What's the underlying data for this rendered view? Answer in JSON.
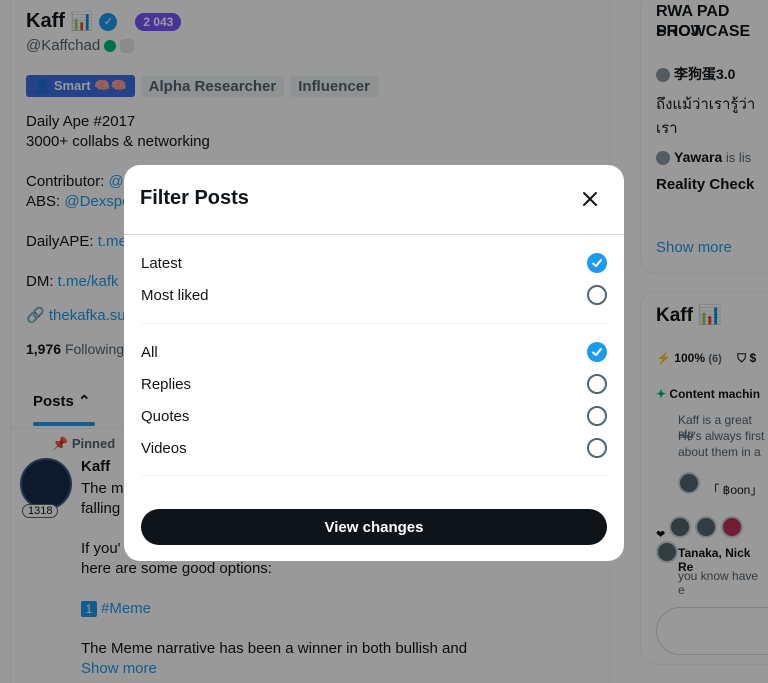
{
  "profile": {
    "name": "Kaff",
    "emoji": "📊",
    "badge_count": "2 043",
    "handle": "@Kaffchad",
    "tags": {
      "smart": "Smart",
      "alpha": "Alpha Researcher",
      "influencer": "Influencer"
    },
    "bio": {
      "line1": "Daily Ape #2017",
      "line2": "3000+ collabs & networking",
      "contributor_label": "Contributor: ",
      "contributor_link": "@",
      "abs_label": "ABS: ",
      "abs_link": "@Dexspo",
      "dailyape_label": "DailyAPE: ",
      "dailyape_link": "t.me",
      "dm_label": "DM: ",
      "dm_link": "t.me/kafk"
    },
    "website": "thekafka.su",
    "following_count": "1,976",
    "following_label": "Following"
  },
  "tabs": {
    "posts": "Posts"
  },
  "post": {
    "pinned_label": "Pinned",
    "author": "Kaff",
    "avatar_badge": "1318",
    "line1": "The m",
    "line2": "falling",
    "line3": "If you'",
    "line4": "here are some good options:",
    "meme_num": "1",
    "meme_tag": "#Meme",
    "line5": "The Meme narrative has been a winner in both bullish and",
    "show_more": "Show more"
  },
  "right": {
    "event_title_1": "RWA PAD PROJ",
    "event_title_2": "SHOWCASE",
    "user1": "李狗蛋3.0",
    "thai_text": "ถึงแม้ว่าเรารู้ว่าเรา",
    "user2": "Yawara",
    "user2_suffix": " is lis",
    "reality": "Reality Check",
    "show_more": "Show more",
    "kaff_title": "Kaff 📊",
    "percent": "100%",
    "percent_count": "(6)",
    "dollar": "$",
    "content_label": "Content machin",
    "desc1": "Kaff is a great alp",
    "desc2": "He's always first",
    "desc3": "about them in a",
    "moon": "「 ฿oon」",
    "names": "Tanaka, Nick Re",
    "you_know": "you know have e"
  },
  "modal": {
    "title": "Filter Posts",
    "sort_options": [
      {
        "label": "Latest",
        "checked": true
      },
      {
        "label": "Most liked",
        "checked": false
      }
    ],
    "type_options": [
      {
        "label": "All",
        "checked": true
      },
      {
        "label": "Replies",
        "checked": false
      },
      {
        "label": "Quotes",
        "checked": false
      },
      {
        "label": "Videos",
        "checked": false
      }
    ],
    "view_changes": "View changes"
  },
  "colors": {
    "accent": "#1d9bf0",
    "badge_purple": "#7856ff",
    "smart_blue": "#3b6ee5",
    "button_dark": "#0f1419"
  }
}
